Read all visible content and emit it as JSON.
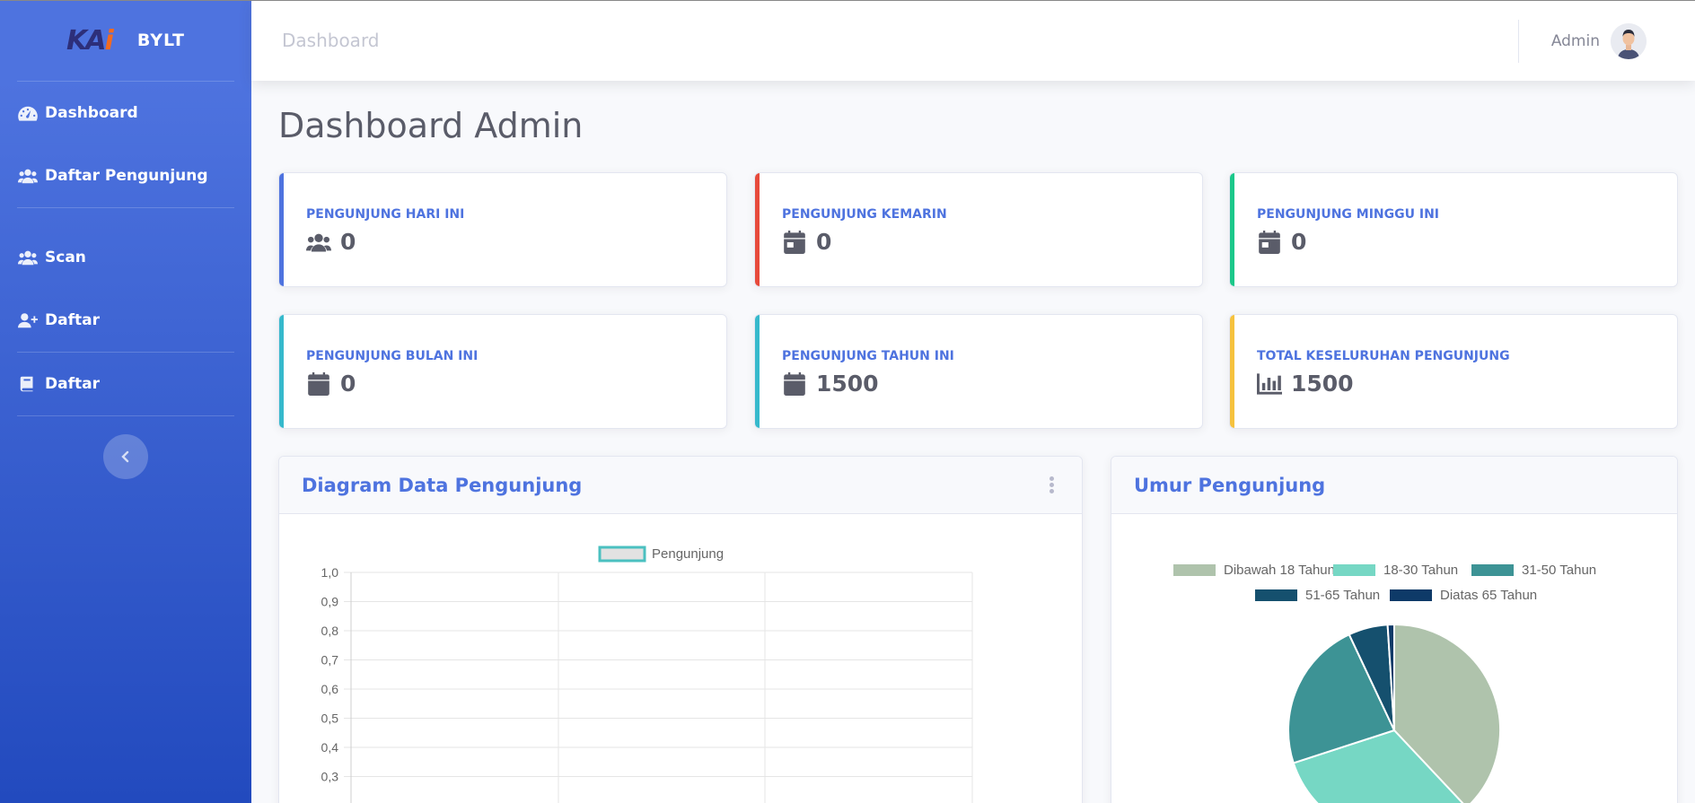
{
  "sidebar": {
    "brand_logo": "KAI",
    "brand_name": "BYLT",
    "items": [
      {
        "label": "Dashboard",
        "icon": "tachometer-icon"
      },
      {
        "label": "Daftar Pengunjung",
        "icon": "users-icon"
      },
      {
        "label": "Scan",
        "icon": "users-icon"
      },
      {
        "label": "Daftar",
        "icon": "user-plus-icon"
      },
      {
        "label": "Daftar",
        "icon": "book-icon"
      }
    ],
    "toggle_icon": "chevron-left-icon"
  },
  "topbar": {
    "title": "Dashboard",
    "user_name": "Admin"
  },
  "page_title": "Dashboard Admin",
  "stats": [
    {
      "label": "PENGUNJUNG HARI INI",
      "value": "0",
      "icon": "users-icon",
      "accent": "#4e73df"
    },
    {
      "label": "PENGUNJUNG KEMARIN",
      "value": "0",
      "icon": "calendar-icon",
      "accent": "#e74a3b"
    },
    {
      "label": "PENGUNJUNG MINGGU INI",
      "value": "0",
      "icon": "calendar-icon",
      "accent": "#1cc88a"
    },
    {
      "label": "PENGUNJUNG BULAN INI",
      "value": "0",
      "icon": "calendar-icon",
      "accent": "#36b9cc"
    },
    {
      "label": "PENGUNJUNG TAHUN INI",
      "value": "1500",
      "icon": "calendar-icon",
      "accent": "#36b9cc"
    },
    {
      "label": "TOTAL KESELURUHAN PENGUNJUNG",
      "value": "1500",
      "icon": "chart-bar-icon",
      "accent": "#f6c23e"
    }
  ],
  "panels": {
    "visitors": {
      "title": "Diagram Data Pengunjung"
    },
    "age": {
      "title": "Umur Pengunjung"
    }
  },
  "chart_data": [
    {
      "type": "line",
      "title": "",
      "legend": [
        "Pengunjung"
      ],
      "legend_placement": "top",
      "series": [
        {
          "name": "Pengunjung",
          "values": [],
          "color": "#4bc0c0"
        }
      ],
      "y_ticks": [
        "1,0",
        "0,9",
        "0,8",
        "0,7",
        "0,6",
        "0,5",
        "0,4",
        "0,3"
      ],
      "ylim": [
        0,
        1
      ],
      "grid": true
    },
    {
      "type": "pie",
      "title": "",
      "legend_placement": "top",
      "categories": [
        "Dibawah 18 Tahun",
        "18-30 Tahun",
        "31-50 Tahun",
        "51-65 Tahun",
        "Diatas 65 Tahun"
      ],
      "values": [
        38,
        32,
        23,
        6,
        1
      ],
      "colors": [
        "#afc3ac",
        "#76d7c4",
        "#3d9395",
        "#15506e",
        "#0e3a68"
      ]
    }
  ]
}
